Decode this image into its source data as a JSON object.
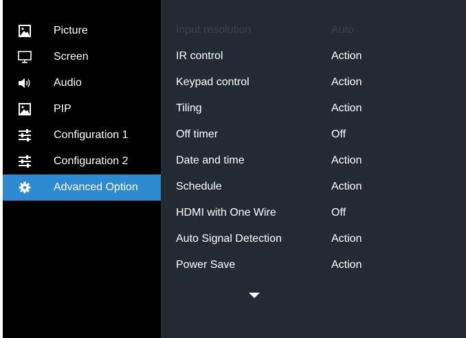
{
  "sidebar": {
    "items": [
      {
        "label": "Picture",
        "icon": "picture-icon"
      },
      {
        "label": "Screen",
        "icon": "monitor-icon"
      },
      {
        "label": "Audio",
        "icon": "speaker-icon"
      },
      {
        "label": "PIP",
        "icon": "picture-icon"
      },
      {
        "label": "Configuration 1",
        "icon": "sliders-icon"
      },
      {
        "label": "Configuration 2",
        "icon": "sliders-icon"
      },
      {
        "label": "Advanced Option",
        "icon": "gear-icon",
        "selected": true
      }
    ]
  },
  "menu": {
    "rows": [
      {
        "name": "Input resolution",
        "value": "Auto",
        "disabled": true
      },
      {
        "name": "IR control",
        "value": "Action"
      },
      {
        "name": "Keypad control",
        "value": "Action"
      },
      {
        "name": "Tiling",
        "value": "Action"
      },
      {
        "name": "Off timer",
        "value": "Off"
      },
      {
        "name": "Date and time",
        "value": "Action"
      },
      {
        "name": "Schedule",
        "value": "Action"
      },
      {
        "name": "HDMI with One Wire",
        "value": "Off"
      },
      {
        "name": "Auto Signal Detection",
        "value": "Action"
      },
      {
        "name": "Power Save",
        "value": "Action"
      }
    ],
    "scroll_icon": "triangle-down-icon"
  },
  "colors": {
    "sidebar_bg": "#000000",
    "main_bg": "#222a33",
    "selected_bg": "#2f8bd1",
    "text": "#ffffff",
    "disabled_text": "#3a4350"
  }
}
